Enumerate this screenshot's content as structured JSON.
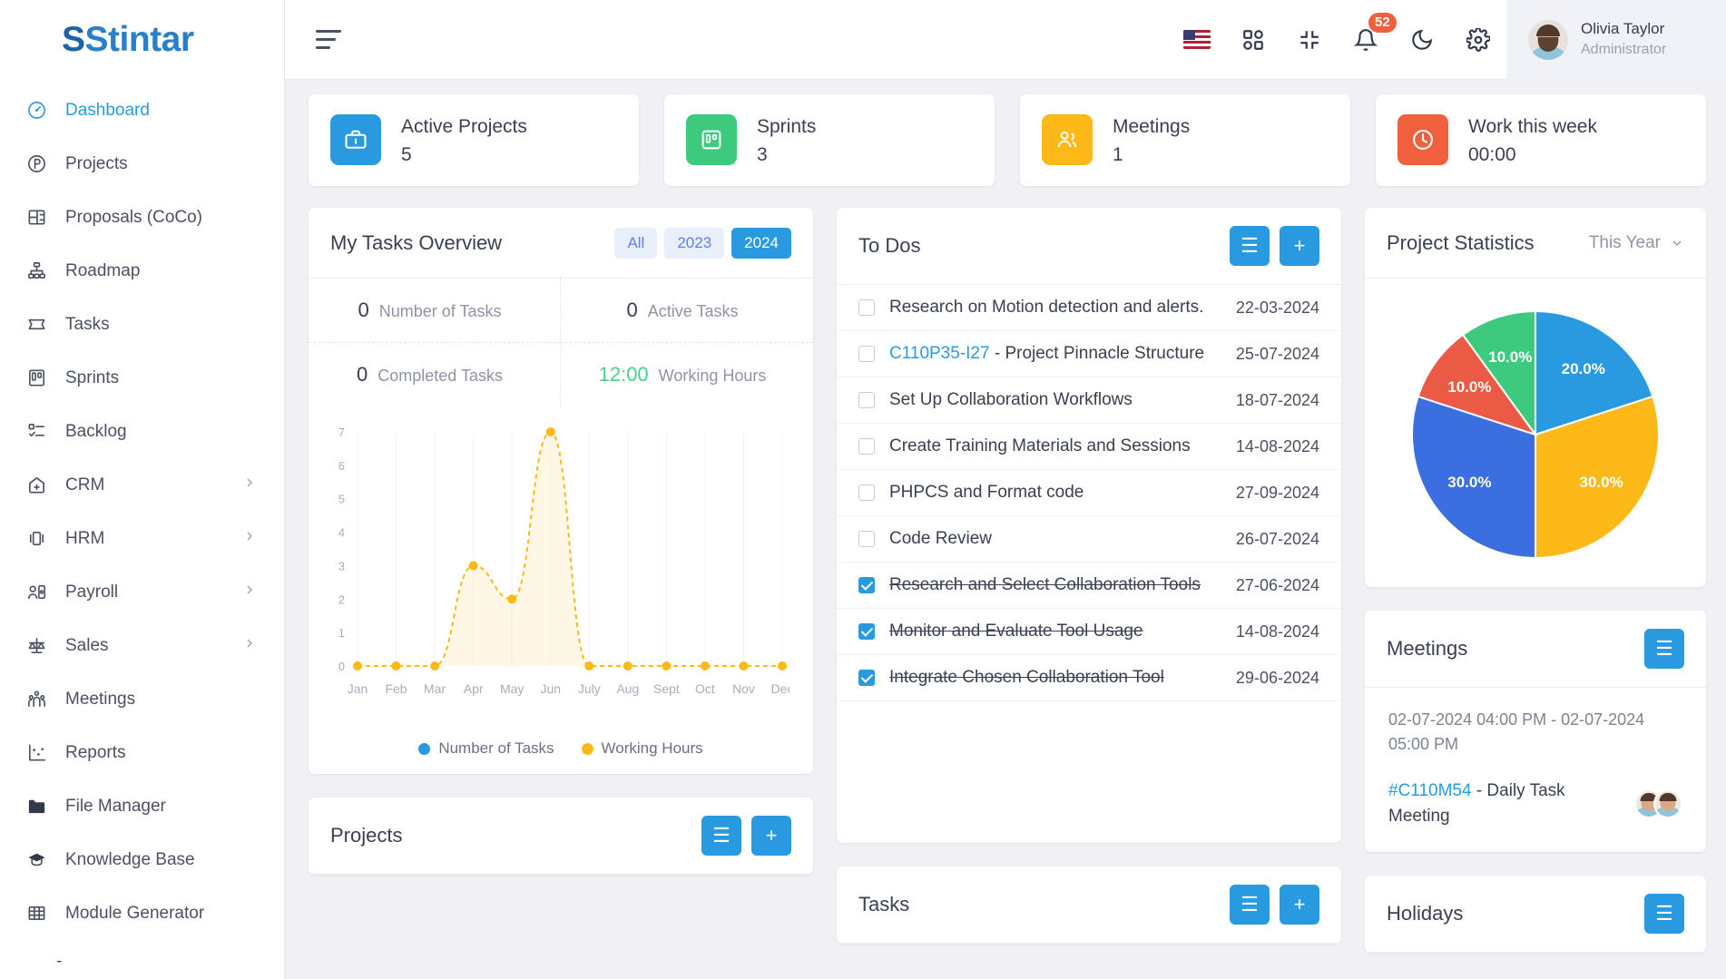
{
  "brand": {
    "name": "Stintar",
    "accent": "#2a9ae0"
  },
  "sidebar": {
    "items": [
      {
        "label": "Dashboard",
        "icon": "speedometer-icon",
        "active": true,
        "chevron": false
      },
      {
        "label": "Projects",
        "icon": "projects-circle-icon",
        "active": false,
        "chevron": false
      },
      {
        "label": "Proposals (CoCo)",
        "icon": "proposals-icon",
        "active": false,
        "chevron": false
      },
      {
        "label": "Roadmap",
        "icon": "roadmap-icon",
        "active": false,
        "chevron": false
      },
      {
        "label": "Tasks",
        "icon": "tasks-icon",
        "active": false,
        "chevron": false
      },
      {
        "label": "Sprints",
        "icon": "sprints-board-icon",
        "active": false,
        "chevron": false
      },
      {
        "label": "Backlog",
        "icon": "backlog-icon",
        "active": false,
        "chevron": false
      },
      {
        "label": "CRM",
        "icon": "crm-icon",
        "active": false,
        "chevron": true
      },
      {
        "label": "HRM",
        "icon": "hrm-icon",
        "active": false,
        "chevron": true
      },
      {
        "label": "Payroll",
        "icon": "payroll-icon",
        "active": false,
        "chevron": true
      },
      {
        "label": "Sales",
        "icon": "scales-icon",
        "active": false,
        "chevron": true
      },
      {
        "label": "Meetings",
        "icon": "meetings-people-icon",
        "active": false,
        "chevron": false
      },
      {
        "label": "Reports",
        "icon": "reports-chart-icon",
        "active": false,
        "chevron": false
      },
      {
        "label": "File Manager",
        "icon": "folder-icon",
        "active": false,
        "chevron": false
      },
      {
        "label": "Knowledge Base",
        "icon": "graduation-cap-icon",
        "active": false,
        "chevron": false
      },
      {
        "label": "Module Generator",
        "icon": "grid-table-icon",
        "active": false,
        "chevron": false
      }
    ],
    "trailing": "-"
  },
  "topbar": {
    "menu_icon": "hamburger-icon",
    "flag_icon": "us-flag-icon",
    "apps_icon": "apps-grid-icon",
    "collapse_icon": "collapse-screen-icon",
    "bell_icon": "bell-icon",
    "notification_count": "52",
    "moon_icon": "dark-mode-icon",
    "gear_icon": "settings-gear-icon",
    "user": {
      "name": "Olivia Taylor",
      "role": "Administrator"
    }
  },
  "stats": [
    {
      "title": "Active Projects",
      "value": "5",
      "icon": "briefcase-icon",
      "color": "#2a9ae0"
    },
    {
      "title": "Sprints",
      "value": "3",
      "icon": "board-icon",
      "color": "#3dc97e"
    },
    {
      "title": "Meetings",
      "value": "1",
      "icon": "users-icon",
      "color": "#fcb918"
    },
    {
      "title": "Work this week",
      "value": "00:00",
      "icon": "clock-icon",
      "color": "#f1603c"
    }
  ],
  "tasks_overview": {
    "title": "My Tasks Overview",
    "filters": [
      {
        "label": "All",
        "active": false
      },
      {
        "label": "2023",
        "active": false
      },
      {
        "label": "2024",
        "active": true
      }
    ],
    "cells": [
      {
        "num": "0",
        "label": "Number of Tasks",
        "green": false
      },
      {
        "num": "0",
        "label": "Active Tasks",
        "green": false
      },
      {
        "num": "0",
        "label": "Completed Tasks",
        "green": false
      },
      {
        "num": "12:00",
        "label": "Working Hours",
        "green": true
      }
    ]
  },
  "chart_data": {
    "type": "line",
    "title": "My Tasks Overview",
    "xlabel": "",
    "ylabel": "",
    "x": [
      "Jan",
      "Feb",
      "Mar",
      "Apr",
      "May",
      "Jun",
      "July",
      "Aug",
      "Sept",
      "Oct",
      "Nov",
      "Dec"
    ],
    "yticks": [
      "0",
      "1",
      "2",
      "3",
      "4",
      "5",
      "6",
      "7"
    ],
    "ylim": [
      0,
      7
    ],
    "grid": true,
    "legend_position": "bottom",
    "series": [
      {
        "name": "Number of Tasks",
        "color": "#2a9ae0",
        "values": [
          0,
          0,
          0,
          0,
          0,
          0,
          0,
          0,
          0,
          0,
          0,
          0
        ]
      },
      {
        "name": "Working Hours",
        "color": "#fcb918",
        "values": [
          0,
          0,
          0,
          3,
          2,
          7,
          0,
          0,
          0,
          0,
          0,
          0
        ]
      }
    ]
  },
  "todos": {
    "title": "To Dos",
    "list_icon": "list-icon",
    "add_icon": "plus-icon",
    "items": [
      {
        "code": "",
        "text": "Research on Motion detection and alerts.",
        "date": "22-03-2024",
        "done": false
      },
      {
        "code": "C110P35-I27",
        "text": " - Project Pinnacle Structure",
        "date": "25-07-2024",
        "done": false
      },
      {
        "code": "",
        "text": "Set Up Collaboration Workflows",
        "date": "18-07-2024",
        "done": false
      },
      {
        "code": "",
        "text": "Create Training Materials and Sessions",
        "date": "14-08-2024",
        "done": false
      },
      {
        "code": "",
        "text": "PHPCS and Format code",
        "date": "27-09-2024",
        "done": false
      },
      {
        "code": "",
        "text": "Code Review",
        "date": "26-07-2024",
        "done": false
      },
      {
        "code": "",
        "text": "Research and Select Collaboration Tools",
        "date": "27-06-2024",
        "done": true
      },
      {
        "code": "",
        "text": "Monitor and Evaluate Tool Usage",
        "date": "14-08-2024",
        "done": true
      },
      {
        "code": "",
        "text": "Integrate Chosen Collaboration Tool",
        "date": "29-06-2024",
        "done": true
      }
    ]
  },
  "project_statistics": {
    "title": "Project Statistics",
    "period": "This Year",
    "chevron_icon": "chevron-down-icon",
    "chart": {
      "type": "pie",
      "title": "Project Statistics",
      "labels": [
        "20.0%",
        "30.0%",
        "30.0%",
        "10.0%",
        "10.0%"
      ],
      "values": [
        20.0,
        30.0,
        30.0,
        10.0,
        10.0
      ],
      "colors": [
        "#2a9ae0",
        "#fcb918",
        "#3b6fe0",
        "#ea5a44",
        "#3dc97e"
      ]
    }
  },
  "meetings": {
    "title": "Meetings",
    "list_icon": "list-icon",
    "time": "02-07-2024 04:00 PM - 02-07-2024 05:00 PM",
    "code": "#C110M54",
    "name": " - Daily Task Meeting"
  },
  "bottom_panels": [
    {
      "title": "Projects",
      "list_icon": "list-icon",
      "add_icon": "plus-icon",
      "has_add": true
    },
    {
      "title": "Tasks",
      "list_icon": "list-icon",
      "add_icon": "plus-icon",
      "has_add": true
    },
    {
      "title": "Holidays",
      "list_icon": "list-icon",
      "add_icon": "plus-icon",
      "has_add": false
    }
  ]
}
